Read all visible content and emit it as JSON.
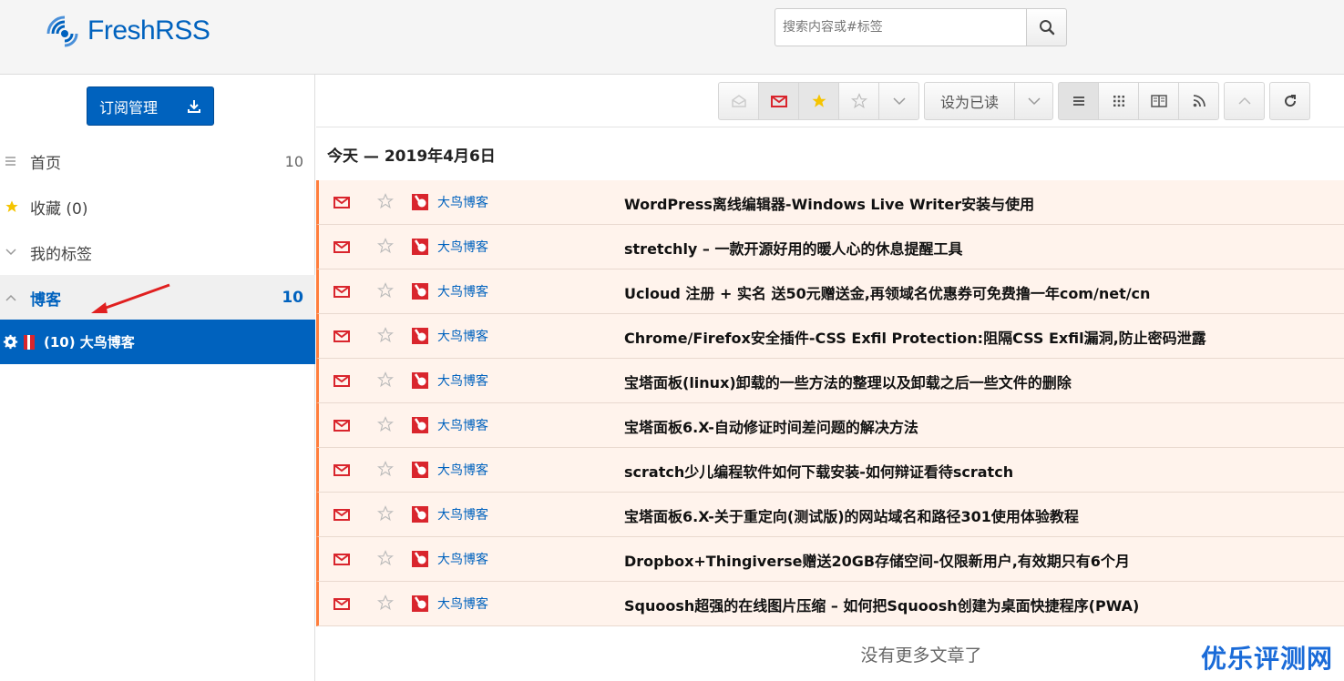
{
  "header": {
    "logo_text": "FreshRSS",
    "search_placeholder": "搜索内容或#标签"
  },
  "sidebar": {
    "manage_button": "订阅管理",
    "items": [
      {
        "label": "首页",
        "count": "10",
        "icon": "list-icon"
      },
      {
        "label": "收藏 (0)",
        "count": "",
        "icon": "star-icon"
      },
      {
        "label": "我的标签",
        "count": "",
        "icon": "chevron-down-icon"
      }
    ],
    "category": {
      "label": "博客",
      "count": "10"
    },
    "feed": {
      "label": "(10) 大鸟博客"
    }
  },
  "toolbar": {
    "mark_read_label": "设为已读"
  },
  "main": {
    "day_header": "今天 — 2019年4月6日",
    "no_more": "没有更多文章了"
  },
  "articles": [
    {
      "site": "大鸟博客",
      "title": "WordPress离线编辑器-Windows Live Writer安装与使用"
    },
    {
      "site": "大鸟博客",
      "title": "stretchly – 一款开源好用的暖人心的休息提醒工具"
    },
    {
      "site": "大鸟博客",
      "title": "Ucloud 注册 + 实名 送50元赠送金,再领域名优惠券可免费撸一年com/net/cn"
    },
    {
      "site": "大鸟博客",
      "title": "Chrome/Firefox安全插件-CSS Exfil Protection:阻隔CSS Exfil漏洞,防止密码泄露"
    },
    {
      "site": "大鸟博客",
      "title": "宝塔面板(linux)卸载的一些方法的整理以及卸载之后一些文件的删除"
    },
    {
      "site": "大鸟博客",
      "title": "宝塔面板6.X-自动修证时间差问题的解决方法"
    },
    {
      "site": "大鸟博客",
      "title": "scratch少儿编程软件如何下载安装-如何辩证看待scratch"
    },
    {
      "site": "大鸟博客",
      "title": "宝塔面板6.X-关于重定向(测试版)的网站域名和路径301使用体验教程"
    },
    {
      "site": "大鸟博客",
      "title": "Dropbox+Thingiverse赠送20GB存储空间-仅限新用户,有效期只有6个月"
    },
    {
      "site": "大鸟博客",
      "title": "Squoosh超强的在线图片压缩 – 如何把Squoosh创建为桌面快捷程序(PWA)"
    }
  ],
  "watermark": "优乐评测网",
  "colors": {
    "accent": "#0062be",
    "unread_bg": "#fff3ec",
    "unread_border": "#ff7e3c",
    "mail_red": "#d9252d"
  }
}
